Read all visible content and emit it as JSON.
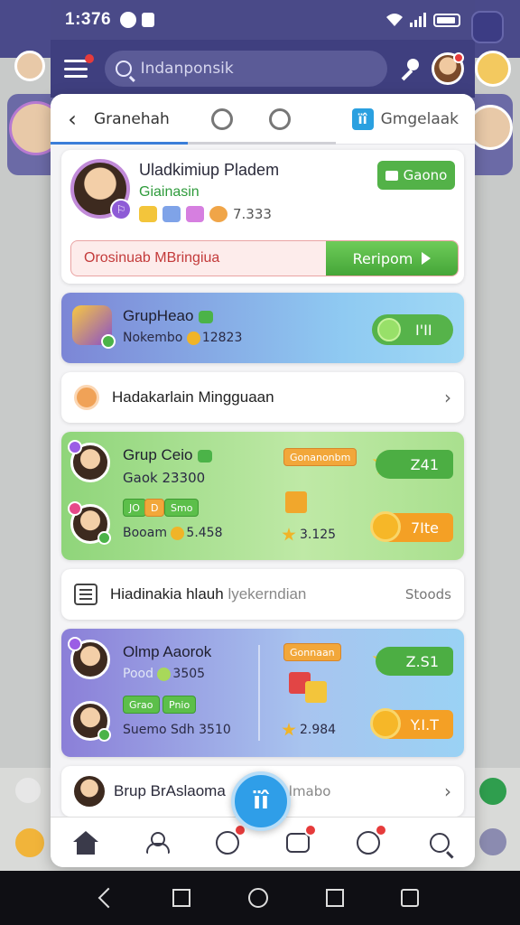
{
  "status_bar": {
    "time": "1:376"
  },
  "header": {
    "search_placeholder": "Indanponsik"
  },
  "tabs": {
    "back_label": "‹",
    "active": "Granehah",
    "last": "Gmgelaak",
    "last_icon_text": "ïî"
  },
  "profile": {
    "name": "Uladkimiup Pladem",
    "subtitle": "Giainasin",
    "count": "7.333",
    "badge_text": "⚐",
    "action_label": "Gaono",
    "promo_text": "Orosinuab MBringiua",
    "promo_button": "Reripom"
  },
  "group_head": {
    "title": "GrupHeao",
    "sub_label": "Nokembo",
    "sub_value": "12823",
    "pill_value": "I'II"
  },
  "weekly_row": {
    "label": "Hadakarlain Mingguaan",
    "chevron": "›"
  },
  "group_green": {
    "title": "Grup Ceio",
    "sub": "Gaok 23300",
    "tag_top": "Gonanonbm",
    "tag_a": "JO",
    "tag_b": "D",
    "tag_c": "Smo",
    "row2_label": "Booam",
    "row2_value": "5.458",
    "star_value": "3.125",
    "pill1": "Z41",
    "pill2": "7Ite"
  },
  "list_row": {
    "label": "Hiadinakia hlauh",
    "label_faded": "lyekerndian",
    "right": "Stoods"
  },
  "group_purple": {
    "title": "Olmp Aaorok",
    "sub_label": "Pood",
    "sub_value": "3505",
    "tag_top": "Gonnaan",
    "tag_a": "Grao",
    "tag_b": "Pnio",
    "row2_label": "Suemo",
    "row2_value": "Sdh 3510",
    "star_value": "2.984",
    "pill1": "Z.S1",
    "pill2": "Y.I.T"
  },
  "bottom_card": {
    "label": "Brup BrAslaoma",
    "faded": "lmabo",
    "chevron": "›"
  },
  "fab": {
    "label": "ïî"
  }
}
